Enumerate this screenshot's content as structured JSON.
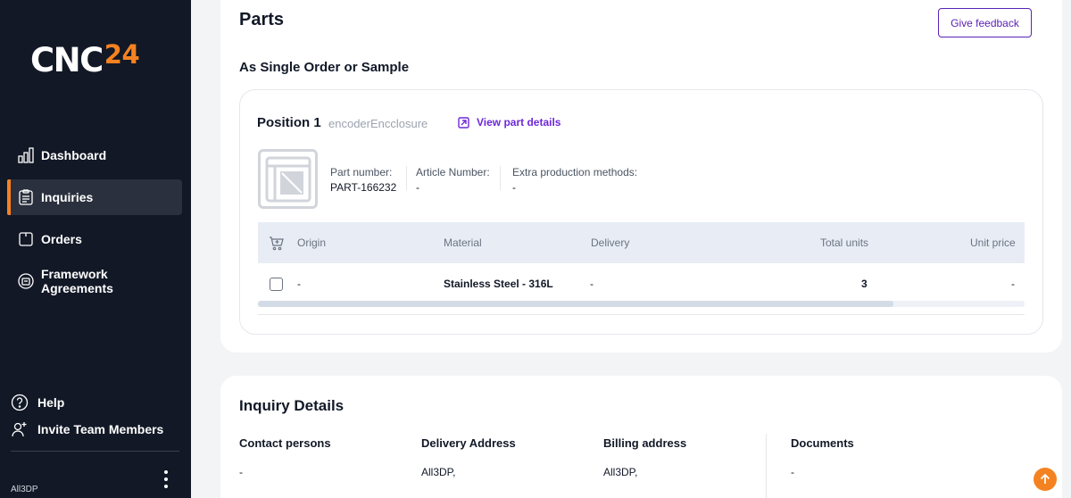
{
  "brand": {
    "name": "CNC",
    "suffix": "24",
    "accent": "#f58220"
  },
  "sidebar": {
    "items": [
      {
        "label": "Dashboard",
        "icon": "bar-chart-icon",
        "active": false
      },
      {
        "label": "Inquiries",
        "icon": "clipboard-list-icon",
        "active": true
      },
      {
        "label": "Orders",
        "icon": "square-icon",
        "active": false
      },
      {
        "label": "Framework Agreements",
        "icon": "agreement-icon",
        "active": false
      }
    ],
    "help_label": "Help",
    "invite_label": "Invite Team Members",
    "account_name": "All3DP"
  },
  "main": {
    "title": "Parts",
    "feedback_label": "Give feedback",
    "section_title": "As Single Order or Sample",
    "position": {
      "title": "Position 1",
      "name": "encoderEncclosure",
      "view_link": "View part details",
      "part_number_label": "Part number:",
      "part_number": "PART-166232",
      "article_number_label": "Article Number:",
      "article_number": "-",
      "extra_methods_label": "Extra production methods:",
      "extra_methods": "-"
    },
    "table": {
      "headers": [
        "Origin",
        "Material",
        "Delivery",
        "Total units",
        "Unit price"
      ],
      "row": {
        "origin": "-",
        "material": "Stainless Steel - 316L",
        "delivery": "-",
        "total_units": "3",
        "unit_price": "-"
      }
    },
    "inquiry": {
      "title": "Inquiry Details",
      "contact_label": "Contact persons",
      "contact_value": "-",
      "delivery_label": "Delivery Address",
      "delivery_value": "All3DP,",
      "billing_label": "Billing address",
      "billing_value": "All3DP,",
      "documents_label": "Documents",
      "documents_value": "-"
    }
  }
}
